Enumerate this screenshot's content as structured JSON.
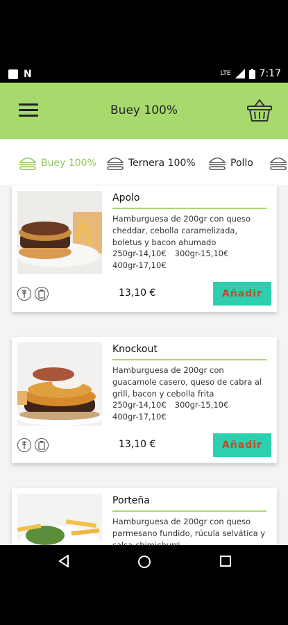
{
  "status_bar": {
    "time": "7:17",
    "network": "LTE"
  },
  "app_bar": {
    "title": "Buey 100%"
  },
  "tabs": [
    {
      "label": "Buey 100%",
      "active": true
    },
    {
      "label": "Ternera 100%",
      "active": false
    },
    {
      "label": "Pollo",
      "active": false
    }
  ],
  "products": [
    {
      "name": "Apolo",
      "description": "Hamburguesa de 200gr con queso cheddar, cebolla caramelizada, boletus y bacon ahumado",
      "price_options": [
        "250gr-14,10€",
        "300gr-15,10€",
        "400gr-17,10€"
      ],
      "price": "13,10 €",
      "add_label": "Añadir"
    },
    {
      "name": "Knockout",
      "description": "Hamburguesa de 200gr con guacamole casero, queso de cabra al grill, bacon y cebolla frita",
      "price_options": [
        "250gr-14,10€",
        "300gr-15,10€",
        "400gr-17,10€"
      ],
      "price": "13,10 €",
      "add_label": "Añadir"
    },
    {
      "name": "Porteña",
      "description": "Hamburguesa de 200gr con queso parmesano fundido, rúcula selvática y salsa chimichurri",
      "price_options": [],
      "price": "",
      "add_label": ""
    }
  ],
  "colors": {
    "app_bar": "#a7d96c",
    "active_tab": "#8cc65a",
    "add_button": "#2ecfae",
    "add_text": "#c44a2a"
  },
  "icons": {
    "menu": "hamburger-menu-icon",
    "cart": "basket-icon",
    "tab": "burger-icon",
    "allergen": "allergen-icon"
  }
}
